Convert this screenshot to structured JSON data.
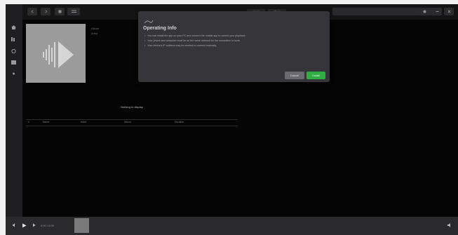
{
  "sidebar": {
    "icons": [
      "home-icon",
      "library-icon",
      "radio-icon",
      "playlist-icon",
      "settings-icon"
    ]
  },
  "toolbar": {
    "tabs": [
      "Songs",
      "Albums"
    ]
  },
  "album": {
    "line1": "Album",
    "line2": "Artist"
  },
  "list": {
    "empty_text": "Nothing to display",
    "columns": [
      "#",
      "Name",
      "Artist",
      "Album",
      "Duration"
    ]
  },
  "player": {
    "time": "0:00 / 0:00"
  },
  "dialog": {
    "title": "Operating Info",
    "items": [
      "You can install the app on your PC and connect the mobile app to control your playback.",
      "Your phone and computer must be on the same network for the connection to work.",
      "Your device's IP address may be needed to connect manually."
    ],
    "cancel_label": "Cancel",
    "install_label": "Install"
  },
  "colors": {
    "background": "#050505",
    "dialog": "#36363a",
    "install_button": "#2fae43",
    "cancel_button": "#6a6a70"
  }
}
